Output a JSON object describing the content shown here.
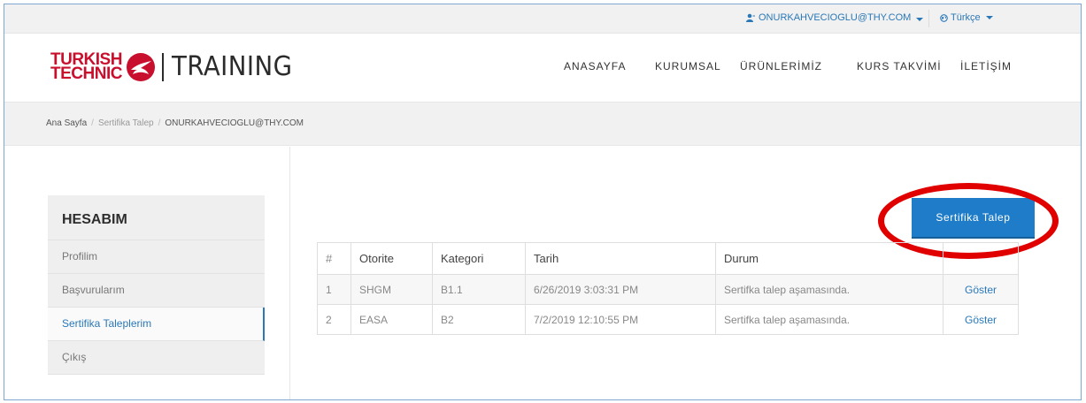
{
  "topbar": {
    "user_email": "ONURKAHVECIOGLU@THY.COM",
    "user_icon": "user-icon",
    "language": "Türkçe",
    "language_icon": "globe-icon"
  },
  "brand": {
    "line1": "TURKISH",
    "line2": "TECHNIC",
    "training": "TRAINING",
    "brand_color": "#c8102e"
  },
  "nav": {
    "items": [
      "ANASAYFA",
      "KURUMSAL",
      "ÜRÜNLERİMİZ",
      "KURS TAKVİMİ",
      "İLETİŞİM"
    ]
  },
  "breadcrumb": {
    "home": "Ana Sayfa",
    "section": "Sertifika Talep",
    "current": "ONURKAHVECIOGLU@THY.COM"
  },
  "sidebar": {
    "title": "HESABIM",
    "items": [
      "Profilim",
      "Başvurularım",
      "Sertifika Taleplerim",
      "Çıkış"
    ],
    "active_index": 2
  },
  "action": {
    "button_label": "Sertifika Talep",
    "accent": "#1e7cc8",
    "highlight_color": "#e00000"
  },
  "table": {
    "headers": [
      "#",
      "Otorite",
      "Kategori",
      "Tarih",
      "Durum",
      ""
    ],
    "rows": [
      [
        "1",
        "SHGM",
        "B1.1",
        "6/26/2019 3:03:31 PM",
        "Sertifka talep aşamasında.",
        "Göster"
      ],
      [
        "2",
        "EASA",
        "B2",
        "7/2/2019 12:10:55 PM",
        "Sertifka talep aşamasında.",
        "Göster"
      ]
    ]
  }
}
